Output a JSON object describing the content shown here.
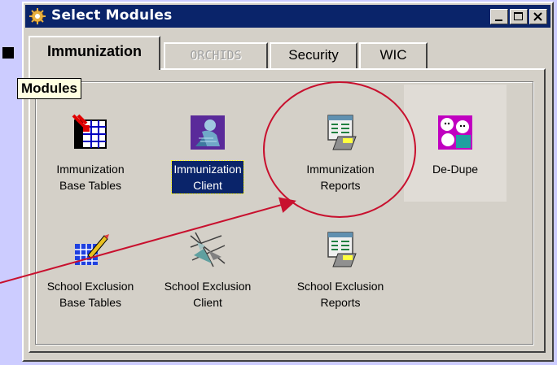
{
  "window": {
    "title": "Select Modules"
  },
  "tabs": [
    {
      "label": "Immunization",
      "active": true
    },
    {
      "label": "ORCHIDS",
      "disabled": true
    },
    {
      "label": "Security"
    },
    {
      "label": "WIC"
    }
  ],
  "group": {
    "label": "Modules"
  },
  "modules": [
    {
      "label": "Immunization\nBase Tables",
      "icon": "grid-table-icon"
    },
    {
      "label": "Immunization\nClient",
      "icon": "client-figure-icon",
      "selected": true
    },
    {
      "label": "Immunization\nReports",
      "icon": "report-printer-icon"
    },
    {
      "label": "De-Dupe",
      "icon": "people-faces-icon"
    },
    {
      "label": "School Exclusion\nBase Tables",
      "icon": "pencil-grid-icon"
    },
    {
      "label": "School Exclusion\nClient",
      "icon": "crossed-lines-icon"
    },
    {
      "label": "School Exclusion\nReports",
      "icon": "report-printer-icon"
    }
  ],
  "colors": {
    "background": "#CCCCFF",
    "titlebar": "#0A246A",
    "annotation": "#C8102E",
    "selection": "#0A246A"
  }
}
